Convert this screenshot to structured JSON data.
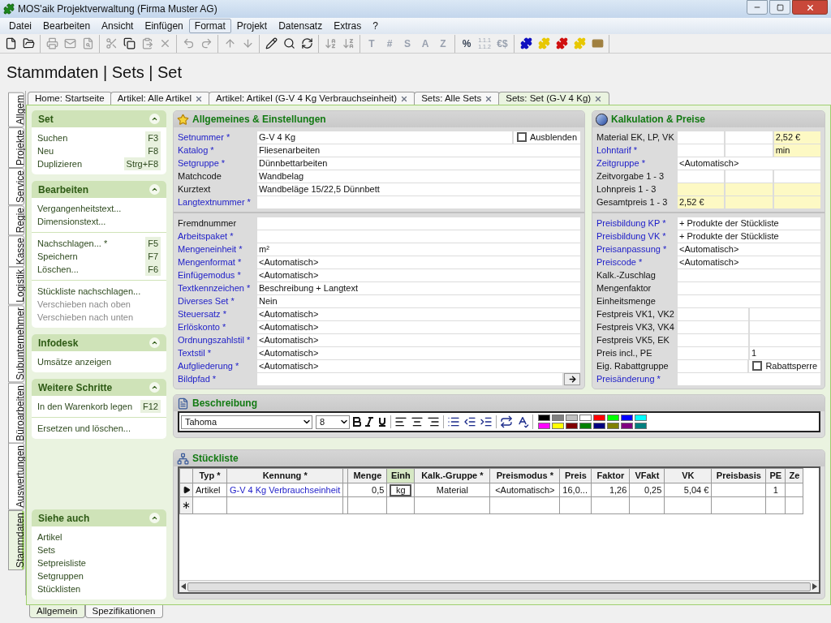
{
  "window": {
    "title": "MOS'aik Projektverwaltung (Firma Muster AG)"
  },
  "menu": [
    {
      "label": "Datei",
      "selected": false
    },
    {
      "label": "Bearbeiten",
      "selected": false
    },
    {
      "label": "Ansicht",
      "selected": false
    },
    {
      "label": "Einfügen",
      "selected": false
    },
    {
      "label": "Format",
      "selected": true
    },
    {
      "label": "Projekt",
      "selected": false
    },
    {
      "label": "Datensatz",
      "selected": false
    },
    {
      "label": "Extras",
      "selected": false
    },
    {
      "label": "?",
      "selected": false
    }
  ],
  "toolbar": [
    [
      {
        "kind": "file",
        "disabled": false
      },
      {
        "kind": "folder",
        "disabled": false
      }
    ],
    [
      {
        "kind": "printer",
        "disabled": true
      },
      {
        "kind": "mail",
        "disabled": true
      },
      {
        "kind": "preview",
        "disabled": true
      }
    ],
    [
      {
        "kind": "scissors",
        "disabled": true
      },
      {
        "kind": "copy",
        "disabled": false
      },
      {
        "kind": "paste",
        "disabled": true
      },
      {
        "kind": "delete",
        "disabled": true
      }
    ],
    [
      {
        "kind": "undo",
        "disabled": true
      },
      {
        "kind": "redo",
        "disabled": true
      }
    ],
    [
      {
        "kind": "up",
        "disabled": true
      },
      {
        "kind": "down",
        "disabled": true
      }
    ],
    [
      {
        "kind": "pencil",
        "disabled": false
      },
      {
        "kind": "search",
        "disabled": false
      },
      {
        "kind": "refresh",
        "disabled": false
      }
    ],
    [
      {
        "kind": "sortaz",
        "disabled": true
      },
      {
        "kind": "sortza",
        "disabled": true
      }
    ],
    [
      {
        "glyph": "T",
        "disabled": true
      },
      {
        "glyph": "#",
        "disabled": true
      },
      {
        "glyph": "S",
        "disabled": true
      },
      {
        "glyph": "A",
        "disabled": true
      },
      {
        "glyph": "Z",
        "disabled": true
      }
    ],
    [
      {
        "glyph": "%",
        "disabled": false
      },
      {
        "glyph": "1.1.1 1.1.2",
        "disabled": true
      },
      {
        "glyph": "€$",
        "disabled": true
      }
    ],
    [
      {
        "kind": "puzzle",
        "color": "#1010c0",
        "disabled": false
      },
      {
        "kind": "puzzle",
        "color": "#e8c800",
        "disabled": false
      },
      {
        "kind": "puzzle",
        "color": "#d01010",
        "disabled": false
      },
      {
        "kind": "puzzle",
        "color": "#e8c800",
        "disabled": false
      },
      {
        "kind": "card",
        "color": "#a08040",
        "disabled": false
      }
    ]
  ],
  "breadcrumb": "Stammdaten | Sets | Set",
  "side_tabs": [
    {
      "label": "Allgem",
      "selected": false
    },
    {
      "label": "Projekte",
      "selected": false
    },
    {
      "label": "Service",
      "selected": false
    },
    {
      "label": "Regie",
      "selected": false
    },
    {
      "label": "Kasse",
      "selected": false
    },
    {
      "label": "Logistik",
      "selected": false
    },
    {
      "label": "Subunternehmer",
      "selected": false
    },
    {
      "label": "Büroarbeiten",
      "selected": false
    },
    {
      "label": "Auswertungen",
      "selected": false
    },
    {
      "label": "Stammdaten",
      "selected": true
    }
  ],
  "doc_tabs": [
    {
      "label": "Home: Startseite",
      "closable": false,
      "selected": false
    },
    {
      "label": "Artikel: Alle Artikel",
      "closable": true,
      "selected": false
    },
    {
      "label": "Artikel: Artikel (G-V 4 Kg Verbrauchseinheit)",
      "closable": true,
      "selected": false
    },
    {
      "label": "Sets: Alle Sets",
      "closable": true,
      "selected": false
    },
    {
      "label": "Sets: Set (G-V 4 Kg)",
      "closable": true,
      "selected": true
    }
  ],
  "sidebar": [
    {
      "title": "Set",
      "groups": [
        [
          {
            "label": "Suchen",
            "shortcut": "F3",
            "disabled": false
          },
          {
            "label": "Neu",
            "shortcut": "F8",
            "disabled": false
          },
          {
            "label": "Duplizieren",
            "shortcut": "Strg+F8",
            "disabled": false
          }
        ]
      ]
    },
    {
      "title": "Bearbeiten",
      "groups": [
        [
          {
            "label": "Vergangenheitstext...",
            "disabled": false
          },
          {
            "label": "Dimensionstext...",
            "disabled": false
          }
        ],
        [
          {
            "label": "Nachschlagen... *",
            "shortcut": "F5",
            "disabled": false
          },
          {
            "label": "Speichern",
            "shortcut": "F7",
            "disabled": false
          },
          {
            "label": "Löschen...",
            "shortcut": "F6",
            "disabled": false
          }
        ],
        [
          {
            "label": "Stückliste nachschlagen...",
            "disabled": false
          },
          {
            "label": "Verschieben nach oben",
            "disabled": true
          },
          {
            "label": "Verschieben nach unten",
            "disabled": true
          }
        ]
      ]
    },
    {
      "title": "Infodesk",
      "groups": [
        [
          {
            "label": "Umsätze anzeigen",
            "disabled": false
          }
        ]
      ]
    },
    {
      "title": "Weitere Schritte",
      "groups": [
        [
          {
            "label": "In den Warenkorb legen",
            "shortcut": "F12",
            "disabled": false
          }
        ],
        [
          {
            "label": "Ersetzen und löschen...",
            "disabled": false
          }
        ]
      ]
    },
    {
      "title": "Siehe auch",
      "groups": [
        [
          {
            "label": "Artikel",
            "disabled": false
          },
          {
            "label": "Sets",
            "disabled": false
          },
          {
            "label": "Setpreisliste",
            "disabled": false
          },
          {
            "label": "Setgruppen",
            "disabled": false
          },
          {
            "label": "Stücklisten",
            "disabled": false
          }
        ]
      ]
    }
  ],
  "general": {
    "title": "Allgemeines & Einstellungen",
    "sections": [
      [
        {
          "label": "Setnummer *",
          "link": true,
          "cells": [
            {
              "value": "G-V 4 Kg"
            }
          ],
          "checkbox": {
            "label": "Ausblenden",
            "checked": false
          }
        },
        {
          "label": "Katalog *",
          "link": true,
          "cells": [
            {
              "value": "Fliesenarbeiten"
            }
          ]
        },
        {
          "label": "Setgruppe *",
          "link": true,
          "cells": [
            {
              "value": "Dünnbettarbeiten"
            }
          ]
        },
        {
          "label": "Matchcode",
          "link": false,
          "cells": [
            {
              "value": "Wandbelag"
            }
          ]
        },
        {
          "label": "Kurztext",
          "link": false,
          "cells": [
            {
              "value": "Wandbeläge 15/22,5 Dünnbett"
            }
          ]
        },
        {
          "label": "Langtextnummer *",
          "link": true,
          "cells": [
            {}
          ]
        }
      ],
      [
        {
          "label": "Fremdnummer",
          "link": false,
          "cells": [
            {}
          ]
        },
        {
          "label": "Arbeitspaket *",
          "link": true,
          "cells": [
            {}
          ]
        },
        {
          "label": "Mengeneinheit *",
          "link": true,
          "cells": [
            {
              "value": "m²"
            }
          ]
        },
        {
          "label": "Mengenformat *",
          "link": true,
          "cells": [
            {
              "value": "<Automatisch>"
            }
          ]
        },
        {
          "label": "Einfügemodus *",
          "link": true,
          "cells": [
            {
              "value": "<Automatisch>"
            }
          ]
        },
        {
          "label": "Textkennzeichen *",
          "link": true,
          "cells": [
            {
              "value": "Beschreibung + Langtext"
            }
          ]
        },
        {
          "label": "Diverses Set *",
          "link": true,
          "cells": [
            {
              "value": "Nein"
            }
          ]
        },
        {
          "label": "Steuersatz *",
          "link": true,
          "cells": [
            {
              "value": "<Automatisch>"
            }
          ]
        },
        {
          "label": "Erlöskonto *",
          "link": true,
          "cells": [
            {
              "value": "<Automatisch>"
            }
          ]
        },
        {
          "label": "Ordnungszahlstil *",
          "link": true,
          "cells": [
            {
              "value": "<Automatisch>"
            }
          ]
        },
        {
          "label": "Textstil *",
          "link": true,
          "cells": [
            {
              "value": "<Automatisch>"
            }
          ]
        },
        {
          "label": "Aufgliederung *",
          "link": true,
          "cells": [
            {
              "value": "<Automatisch>"
            }
          ]
        },
        {
          "label": "Bildpfad *",
          "link": true,
          "cells": [
            {}
          ],
          "browse_button": true
        }
      ]
    ]
  },
  "pricing": {
    "title": "Kalkulation & Preise",
    "sections": [
      [
        {
          "label": "Material EK, LP, VK",
          "link": false,
          "cells": [
            {
              "highlighted": false
            },
            {
              "highlighted": false
            },
            {
              "value": "2,52 €",
              "highlighted": true
            }
          ]
        },
        {
          "label": "Lohntarif *",
          "link": true,
          "cells": [
            {
              "highlighted": false
            },
            {
              "highlighted": false
            },
            {
              "value": "min",
              "highlighted": true
            }
          ]
        },
        {
          "label": "Zeitgruppe *",
          "link": true,
          "cells": [
            {
              "value": "<Automatisch>",
              "highlighted": false
            }
          ]
        },
        {
          "label": "Zeitvorgabe 1 - 3",
          "link": false,
          "cells": [
            {
              "highlighted": false
            },
            {
              "highlighted": false
            },
            {
              "highlighted": false
            }
          ]
        },
        {
          "label": "Lohnpreis 1 - 3",
          "link": false,
          "cells": [
            {
              "highlighted": true
            },
            {
              "highlighted": true
            },
            {
              "highlighted": true
            }
          ]
        },
        {
          "label": "Gesamtpreis 1 - 3",
          "link": false,
          "cells": [
            {
              "value": "2,52 €",
              "highlighted": true
            },
            {
              "highlighted": true
            },
            {
              "highlighted": true
            }
          ]
        }
      ],
      [
        {
          "label": "Preisbildung KP *",
          "link": true,
          "cells": [
            {
              "value": "+ Produkte der Stückliste",
              "highlighted": false
            }
          ]
        },
        {
          "label": "Preisbildung VK *",
          "link": true,
          "cells": [
            {
              "value": "+ Produkte der Stückliste",
              "highlighted": false
            }
          ]
        },
        {
          "label": "Preisanpassung *",
          "link": true,
          "cells": [
            {
              "value": "<Automatisch>",
              "highlighted": false
            }
          ]
        },
        {
          "label": "Preiscode *",
          "link": true,
          "cells": [
            {
              "value": "<Automatisch>",
              "highlighted": false
            }
          ]
        },
        {
          "label": "Kalk.-Zuschlag",
          "link": false,
          "cells": [
            {
              "highlighted": false
            }
          ]
        },
        {
          "label": "Mengenfaktor",
          "link": false,
          "cells": [
            {
              "highlighted": false
            }
          ]
        },
        {
          "label": "Einheitsmenge",
          "link": false,
          "cells": [
            {
              "highlighted": false
            }
          ]
        },
        {
          "label": "Festpreis VK1, VK2",
          "link": false,
          "cells": [
            {
              "highlighted": false
            },
            {
              "highlighted": false
            }
          ]
        },
        {
          "label": "Festpreis VK3, VK4",
          "link": false,
          "cells": [
            {
              "highlighted": false
            },
            {
              "highlighted": false
            }
          ]
        },
        {
          "label": "Festpreis VK5, EK",
          "link": false,
          "cells": [
            {
              "highlighted": false
            },
            {
              "highlighted": false
            }
          ]
        },
        {
          "label": "Preis incl., PE",
          "link": false,
          "cells": [
            {
              "highlighted": false
            },
            {
              "value": "1",
              "highlighted": false
            }
          ]
        },
        {
          "label": "Eig. Rabattgruppe",
          "link": false,
          "cells": [
            {
              "highlighted": false
            }
          ],
          "checkbox": {
            "label": "Rabattsperre",
            "checked": false
          }
        },
        {
          "label": "Preisänderung *",
          "link": true,
          "cells": [
            {
              "highlighted": false
            }
          ]
        }
      ]
    ]
  },
  "description": {
    "title": "Beschreibung",
    "font": "Tahoma",
    "size": "8",
    "colors": [
      {
        "color": "#000000"
      },
      {
        "color": "#808080"
      },
      {
        "color": "#c0c0c0"
      },
      {
        "color": "#ffffff"
      },
      {
        "color": "#ff0000"
      },
      {
        "color": "#00ff00"
      },
      {
        "color": "#0000ff"
      },
      {
        "color": "#00ffff"
      },
      {
        "color": "#ff00ff"
      },
      {
        "color": "#ffff00"
      },
      {
        "color": "#800000"
      },
      {
        "color": "#008000"
      },
      {
        "color": "#000080"
      },
      {
        "color": "#808000"
      },
      {
        "color": "#800080"
      },
      {
        "color": "#008080"
      }
    ]
  },
  "parts_list": {
    "title": "Stückliste",
    "new_row_marker": "∗",
    "columns": [
      {
        "label": "Typ *",
        "selected": false,
        "link": false
      },
      {
        "label": "Kennung *",
        "selected": false,
        "link": true
      },
      {
        "label": "Menge",
        "selected": false,
        "link": false
      },
      {
        "label": "Einh",
        "selected": true,
        "link": false
      },
      {
        "label": "Kalk.-Gruppe *",
        "selected": false,
        "link": false
      },
      {
        "label": "Preismodus *",
        "selected": false,
        "link": false
      },
      {
        "label": "Preis",
        "selected": false,
        "link": false
      },
      {
        "label": "Faktor",
        "selected": false,
        "link": false
      },
      {
        "label": "VFakt",
        "selected": false,
        "link": false
      },
      {
        "label": "VK",
        "selected": false,
        "link": false
      },
      {
        "label": "Preisbasis",
        "selected": false
      },
      {
        "label": "PE",
        "selected": false,
        "link": false
      },
      {
        "label": "Ze",
        "selected": false
      }
    ],
    "rows": [
      {
        "current": true,
        "cells": [
          "Artikel",
          "G-V 4 Kg Verbrauchseinheit",
          "0,5",
          "kg",
          "Material",
          "<Automatisch>",
          "16,0...",
          "1,26",
          "0,25",
          "5,04 €",
          null,
          "1",
          null
        ]
      }
    ]
  },
  "bottom_tabs": [
    {
      "label": "Allgemein",
      "selected": true
    },
    {
      "label": "Spezifikationen",
      "selected": false
    }
  ]
}
